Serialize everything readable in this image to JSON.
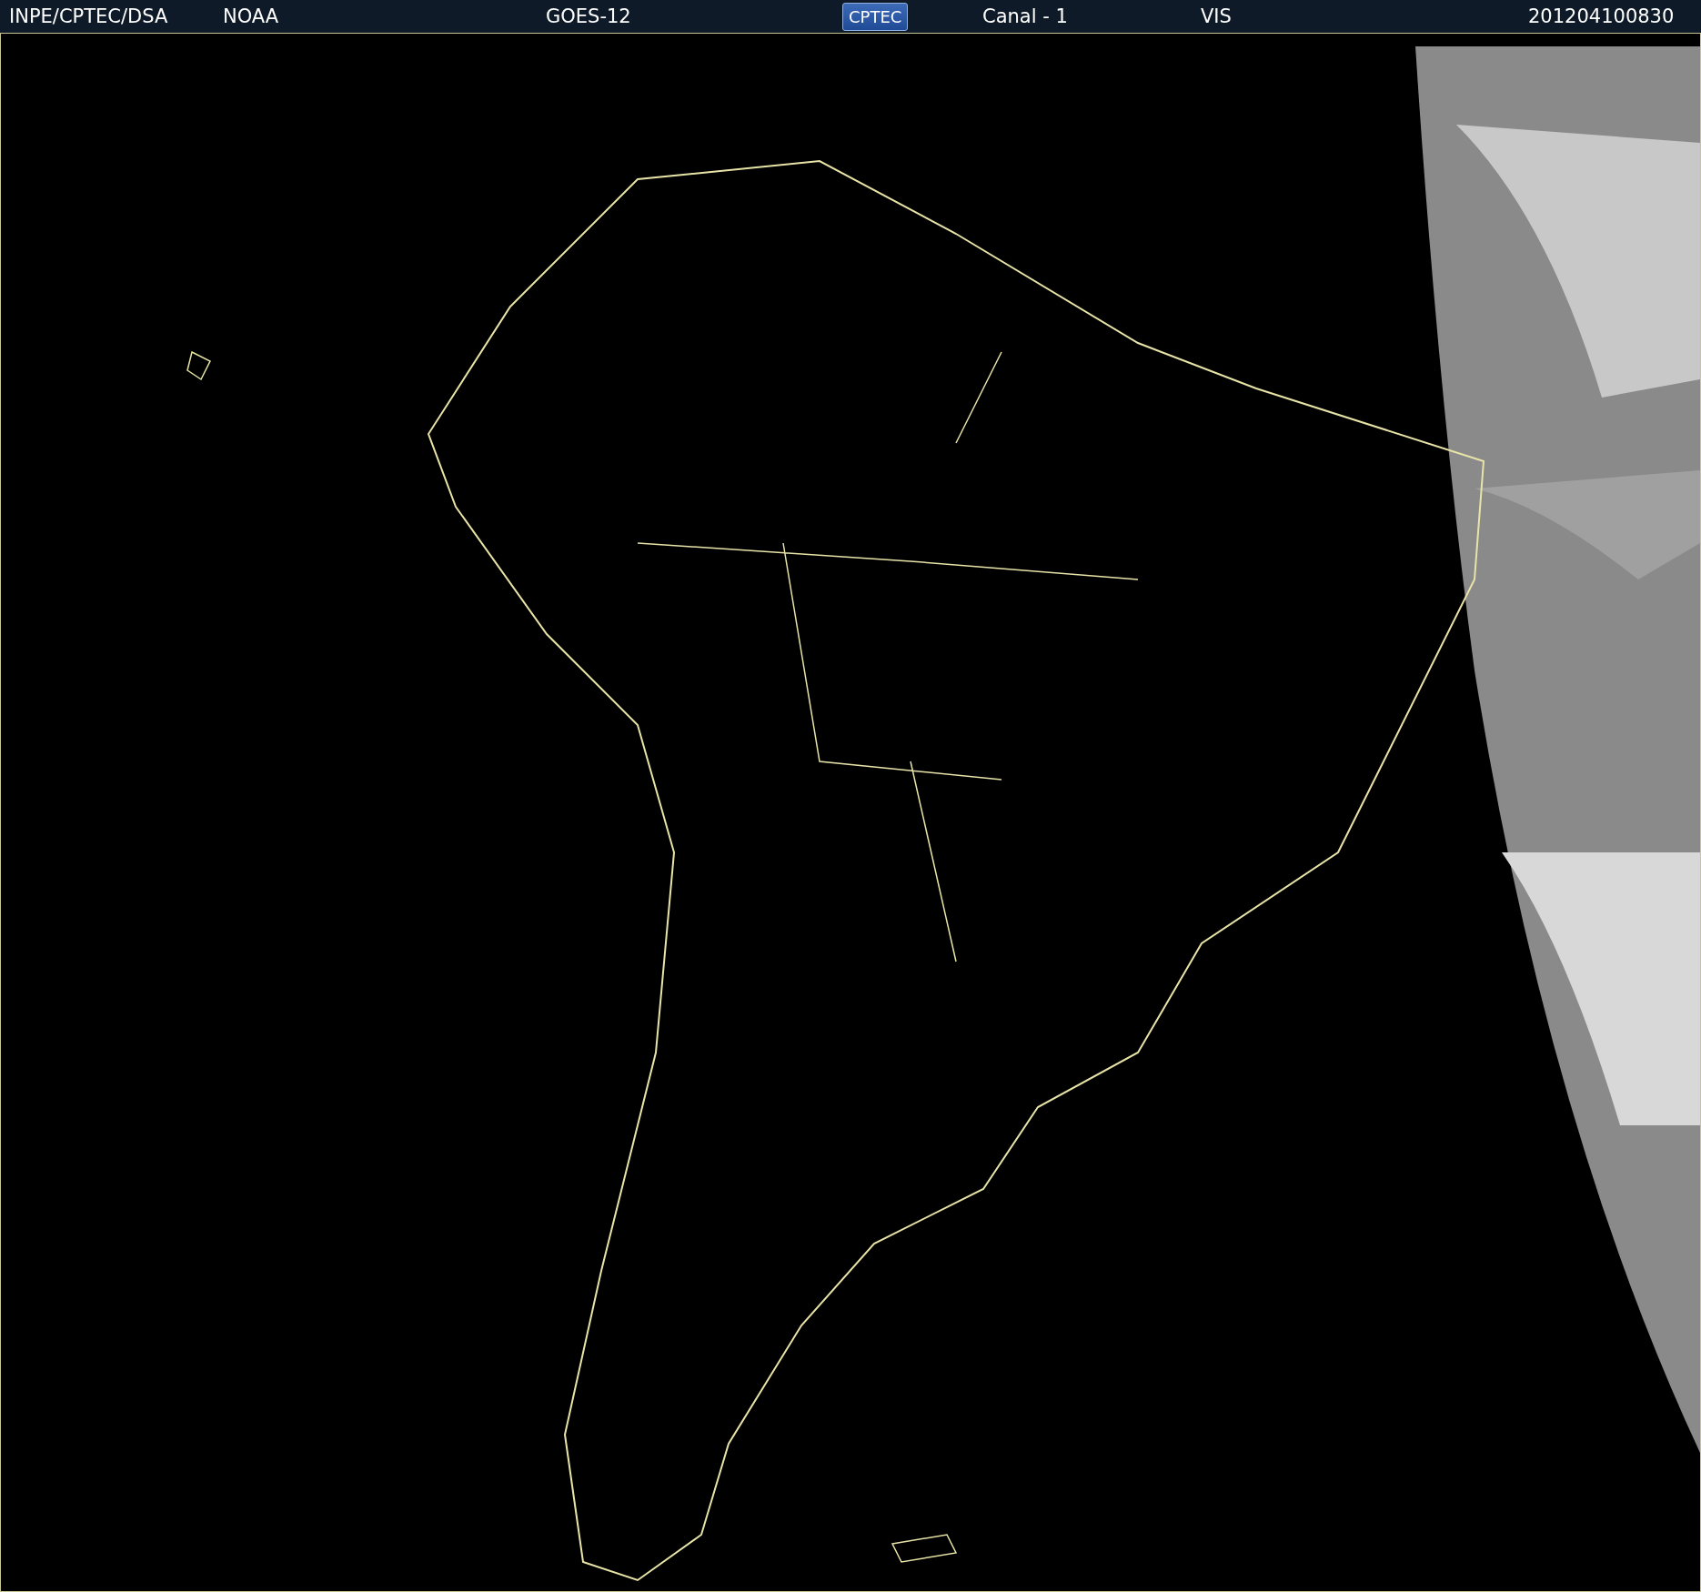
{
  "header": {
    "source": "INPE/CPTEC/DSA",
    "agency": "NOAA",
    "satellite": "GOES-12",
    "logo": "CPTEC",
    "channel": "Canal - 1",
    "band": "VIS",
    "timestamp": "201204100830"
  }
}
